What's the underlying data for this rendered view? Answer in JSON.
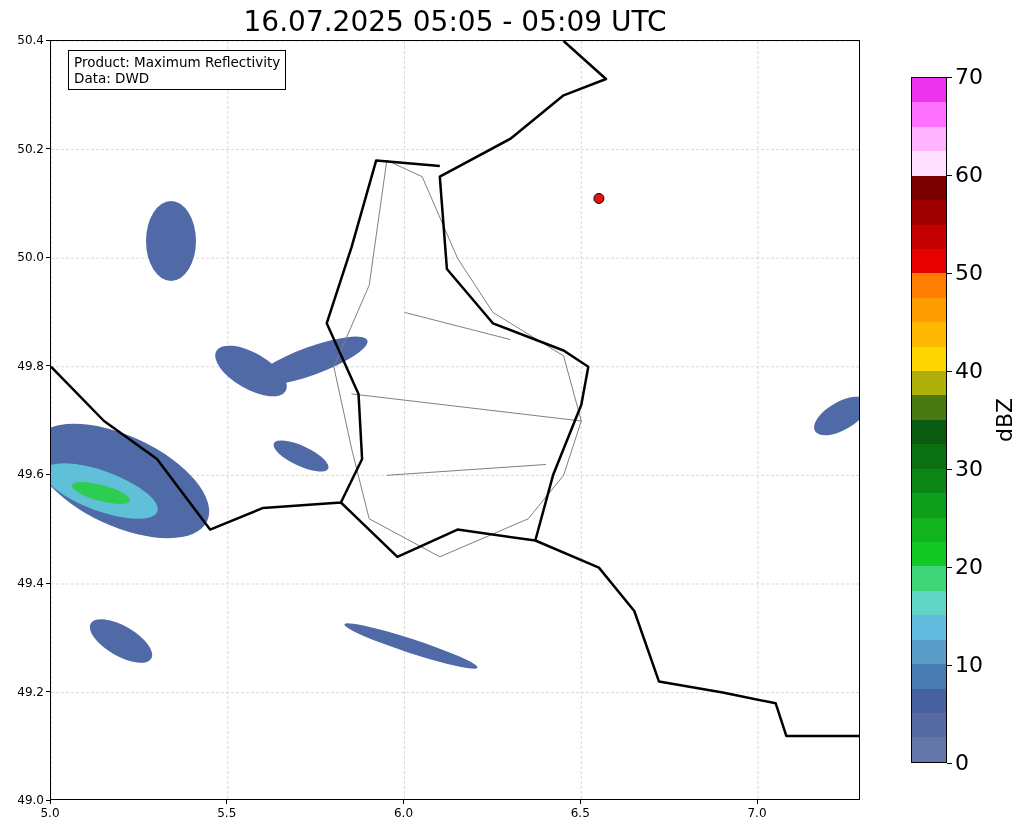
{
  "title": "16.07.2025 05:05 - 05:09 UTC",
  "annotation": [
    "Product: Maximum Reflectivity",
    "Data: DWD"
  ],
  "axes": {
    "xticks": [
      "5.0",
      "5.5",
      "6.0",
      "6.5",
      "7.0"
    ],
    "yticks": [
      "50.4",
      "50.2",
      "50.0",
      "49.8",
      "49.6",
      "49.4",
      "49.2",
      "49.0"
    ]
  },
  "colorbar": {
    "label": "dBZ",
    "ticks": [
      "70",
      "60",
      "50",
      "40",
      "30",
      "20",
      "10",
      "0"
    ],
    "segments": [
      {
        "color": "#ee33ee"
      },
      {
        "color": "#ff70ff"
      },
      {
        "color": "#ffb4ff"
      },
      {
        "color": "#ffe0ff"
      },
      {
        "color": "#7a0000"
      },
      {
        "color": "#a00000"
      },
      {
        "color": "#c40000"
      },
      {
        "color": "#e60000"
      },
      {
        "color": "#ff7e00"
      },
      {
        "color": "#ff9c00"
      },
      {
        "color": "#ffb800"
      },
      {
        "color": "#ffd700"
      },
      {
        "color": "#b0b00a"
      },
      {
        "color": "#4a7812"
      },
      {
        "color": "#0a5a10"
      },
      {
        "color": "#0a7012"
      },
      {
        "color": "#0c8614"
      },
      {
        "color": "#0f9e1a"
      },
      {
        "color": "#12b41e"
      },
      {
        "color": "#14c824"
      },
      {
        "color": "#3ed678"
      },
      {
        "color": "#62d6c6"
      },
      {
        "color": "#62bade"
      },
      {
        "color": "#5a9cc8"
      },
      {
        "color": "#4a7cb4"
      },
      {
        "color": "#4660a0"
      },
      {
        "color": "#566aa2"
      },
      {
        "color": "#6477a8"
      }
    ]
  }
}
